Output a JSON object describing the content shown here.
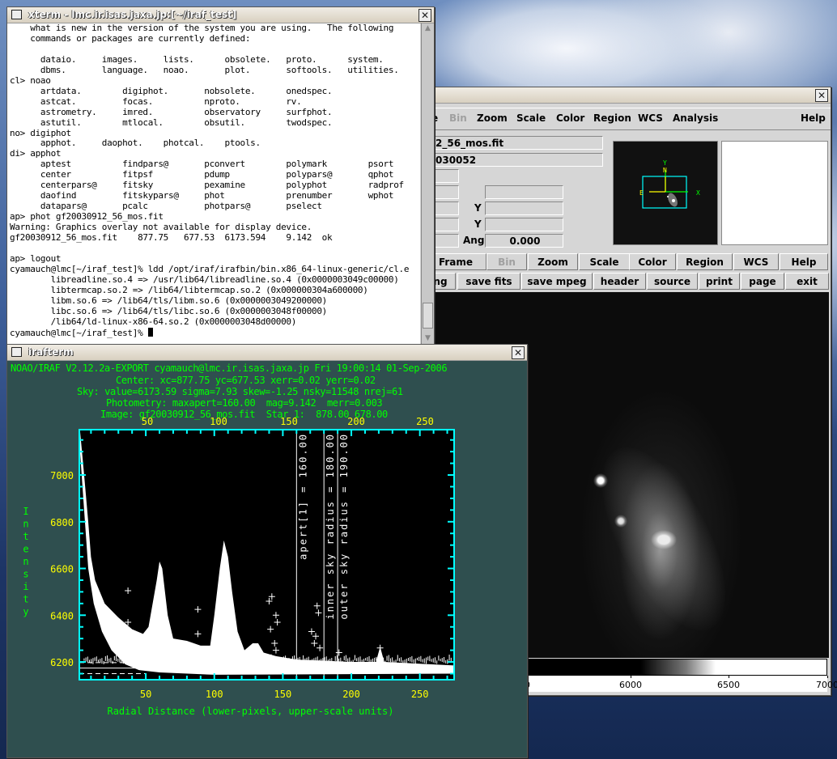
{
  "xterm": {
    "title": "xterm - lmc.ir.isas.jaxa.jp:[~/iraf_test]",
    "lines": [
      "    what is new in the version of the system you are using.   The following",
      "    commands or packages are currently defined:",
      "",
      "      dataio.     images.     lists.      obsolete.   proto.      system.",
      "      dbms.       language.   noao.       plot.       softools.   utilities.",
      "cl> noao",
      "      artdata.        digiphot.       nobsolete.      onedspec.",
      "      astcat.         focas.          nproto.         rv.",
      "      astrometry.     imred.          observatory     surfphot.",
      "      astutil.        mtlocal.        obsutil.        twodspec.",
      "no> digiphot",
      "      apphot.     daophot.    photcal.    ptools.",
      "di> apphot",
      "      aptest          findpars@       pconvert        polymark        psort",
      "      center          fitpsf          pdump           polypars@       qphot",
      "      centerpars@     fitsky          pexamine        polyphot        radprof",
      "      daofind         fitskypars@     phot            prenumber       wphot",
      "      datapars@       pcalc           photpars@       pselect",
      "ap> phot gf20030912_56_mos.fit",
      "Warning: Graphics overlay not available for display device.",
      "gf20030912_56_mos.fit    877.75   677.53  6173.594    9.142  ok",
      "",
      "ap> logout",
      "cyamauch@lmc[~/iraf_test]% ldd /opt/iraf/irafbin/bin.x86_64-linux-generic/cl.e",
      "        libreadline.so.4 => /usr/lib64/libreadline.so.4 (0x0000003049c00000)",
      "        libtermcap.so.2 => /lib64/libtermcap.so.2 (0x000000304a600000)",
      "        libm.so.6 => /lib64/tls/libm.so.6 (0x0000003049200000)",
      "        libc.so.6 => /lib64/tls/libc.so.6 (0x0000003048f00000)",
      "        /lib64/ld-linux-x86-64.so.2 (0x0000003048d00000)"
    ],
    "prompt": "cyamauch@lmc[~/iraf_test]% "
  },
  "irafterm": {
    "title": "irafterm",
    "header_lines": [
      "NOAO/IRAF V2.12.2a-EXPORT cyamauch@lmc.ir.isas.jaxa.jp Fri 19:00:14 01-Sep-2006",
      "Center: xc=877.75 yc=677.53 xerr=0.02 yerr=0.02",
      "Sky: value=6173.59 sigma=7.93 skew=-1.25 nsky=11548 nrej=61",
      "Photometry: maxapert=160.00  mag=9.142  merr=0.003",
      "Image: gf20030912_56_mos.fit  Star 1:  878.00 678.00"
    ]
  },
  "chart_data": {
    "type": "scatter",
    "xlabel": "Radial Distance (lower-pixels, upper-scale units)",
    "ylabel": "Intensity",
    "xlim": [
      1.5,
      275
    ],
    "ylim": [
      6124,
      7194
    ],
    "x_ticks": [
      50,
      100,
      150,
      200,
      250
    ],
    "y_ticks": [
      6200,
      6400,
      6600,
      6800,
      7000
    ],
    "upper_x_ticks": [
      50,
      100,
      150,
      200,
      250
    ],
    "colors": {
      "frame": "#00ffff",
      "points": "#ffffff",
      "tick_labels": "#ffff00",
      "labels": "#00ff00",
      "background": "#000000"
    },
    "profile_upper": [
      [
        2,
        7190
      ],
      [
        5,
        7000
      ],
      [
        8,
        6800
      ],
      [
        10,
        6650
      ],
      [
        13,
        6550
      ],
      [
        20,
        6450
      ],
      [
        30,
        6390
      ],
      [
        40,
        6340
      ],
      [
        48,
        6320
      ],
      [
        52,
        6350
      ],
      [
        55,
        6450
      ],
      [
        58,
        6550
      ],
      [
        60,
        6630
      ],
      [
        62,
        6600
      ],
      [
        64,
        6500
      ],
      [
        66,
        6400
      ],
      [
        70,
        6300
      ],
      [
        80,
        6290
      ],
      [
        90,
        6270
      ],
      [
        97,
        6270
      ],
      [
        100,
        6400
      ],
      [
        104,
        6600
      ],
      [
        107,
        6720
      ],
      [
        110,
        6650
      ],
      [
        113,
        6500
      ],
      [
        117,
        6330
      ],
      [
        122,
        6250
      ],
      [
        128,
        6280
      ],
      [
        132,
        6280
      ],
      [
        136,
        6240
      ],
      [
        145,
        6225
      ],
      [
        160,
        6210
      ],
      [
        200,
        6200
      ],
      [
        218,
        6200
      ],
      [
        221,
        6265
      ],
      [
        224,
        6200
      ],
      [
        275,
        6185
      ]
    ],
    "profile_lower": [
      [
        2,
        7100
      ],
      [
        5,
        6850
      ],
      [
        8,
        6600
      ],
      [
        12,
        6450
      ],
      [
        18,
        6330
      ],
      [
        25,
        6250
      ],
      [
        35,
        6190
      ],
      [
        45,
        6165
      ],
      [
        60,
        6155
      ],
      [
        100,
        6145
      ],
      [
        275,
        6150
      ]
    ],
    "outliers": [
      [
        37,
        6505
      ],
      [
        37,
        6370
      ],
      [
        88,
        6425
      ],
      [
        88,
        6320
      ],
      [
        140,
        6460
      ],
      [
        142,
        6480
      ],
      [
        145,
        6400
      ],
      [
        146,
        6370
      ],
      [
        141,
        6340
      ],
      [
        144,
        6280
      ],
      [
        145,
        6250
      ],
      [
        171,
        6330
      ],
      [
        173,
        6280
      ],
      [
        174,
        6310
      ],
      [
        175,
        6440
      ],
      [
        176,
        6410
      ],
      [
        177,
        6260
      ],
      [
        191,
        6240
      ],
      [
        221,
        6260
      ]
    ],
    "sky_level": 6173.59,
    "sky_band": [
      6150,
      6197
    ],
    "annotations": [
      {
        "x": 160,
        "label": "apert[1] = 160.00"
      },
      {
        "x": 180,
        "label": "inner sky radius = 180.00"
      },
      {
        "x": 190,
        "label": "outer sky radius = 190.00"
      }
    ]
  },
  "ds9": {
    "menu": [
      {
        "label": "e",
        "disabled": false
      },
      {
        "label": "Bin",
        "disabled": true
      },
      {
        "label": "Zoom",
        "disabled": false
      },
      {
        "label": "Scale",
        "disabled": false
      },
      {
        "label": "Color",
        "disabled": false
      },
      {
        "label": "Region",
        "disabled": false
      },
      {
        "label": "WCS",
        "disabled": false
      },
      {
        "label": "Analysis",
        "disabled": false
      },
      {
        "label": "Help",
        "disabled": false
      }
    ],
    "info": {
      "file_value": "2_56_mos.fit",
      "object_value": "030052",
      "y_label_1": "Y",
      "y_label_2": "Y",
      "ang_label": "Ang",
      "ang_value": "0.000"
    },
    "panner_labels": {
      "n": "N",
      "e": "E",
      "x": "X",
      "y": "Y"
    },
    "buttons_row1": [
      {
        "label": "Frame",
        "disabled": false
      },
      {
        "label": "Bin",
        "disabled": true
      },
      {
        "label": "Zoom",
        "disabled": false
      },
      {
        "label": "Scale",
        "disabled": false
      },
      {
        "label": "Color",
        "disabled": false
      },
      {
        "label": "Region",
        "disabled": false
      },
      {
        "label": "WCS",
        "disabled": false
      },
      {
        "label": "Help",
        "disabled": false
      }
    ],
    "buttons_row2": [
      "ng",
      "save fits",
      "save mpeg",
      "header",
      "source",
      "print",
      "page",
      "exit"
    ],
    "colorbar_ticks": [
      "0",
      "6000",
      "6500",
      "7000"
    ]
  }
}
